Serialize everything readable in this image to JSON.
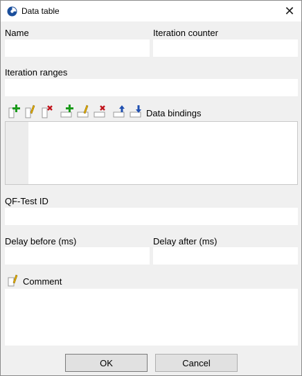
{
  "window": {
    "title": "Data table",
    "close_symbol": "✕"
  },
  "fields": {
    "name_label": "Name",
    "name_value": "",
    "iteration_counter_label": "Iteration counter",
    "iteration_counter_value": "",
    "iteration_ranges_label": "Iteration ranges",
    "iteration_ranges_value": "",
    "qftest_id_label": "QF-Test ID",
    "qftest_id_value": "",
    "delay_before_label": "Delay before (ms)",
    "delay_before_value": "",
    "delay_after_label": "Delay after (ms)",
    "delay_after_value": "",
    "comment_label": "Comment",
    "comment_value": ""
  },
  "data_bindings": {
    "label": "Data bindings",
    "toolbar_icons": [
      "add-column-icon",
      "edit-column-icon",
      "delete-column-icon",
      "add-row-icon",
      "edit-row-icon",
      "delete-row-icon",
      "move-up-icon",
      "move-down-icon"
    ],
    "rows": []
  },
  "buttons": {
    "ok": "OK",
    "cancel": "Cancel"
  },
  "colors": {
    "add_green": "#1a9a1a",
    "delete_red": "#c0141c",
    "edit_yellow": "#e8b000",
    "arrow_blue": "#1f4fb0",
    "icon_blue": "#1b4f9c"
  }
}
